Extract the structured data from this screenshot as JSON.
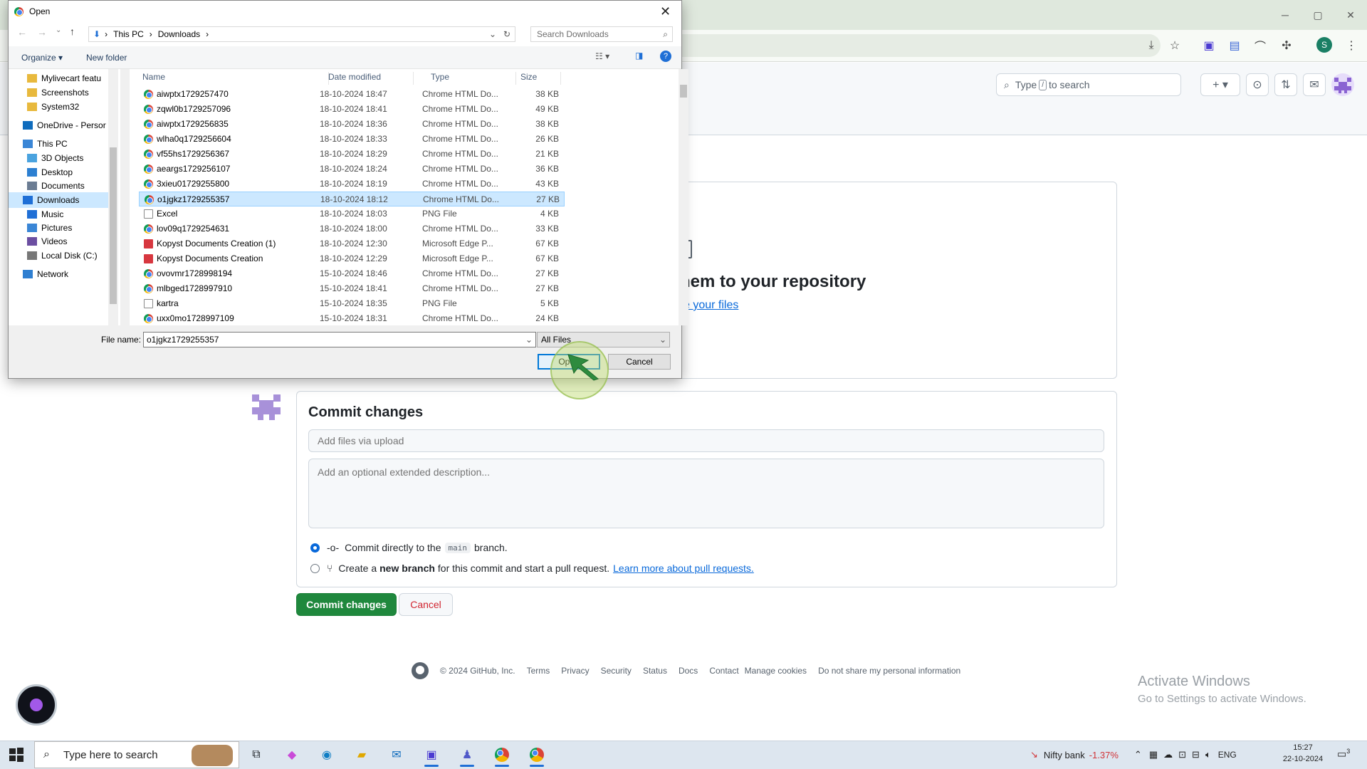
{
  "browser": {
    "window_controls": [
      "─",
      "▢",
      "✕"
    ]
  },
  "github": {
    "search": {
      "prefix": "Type",
      "key": "/",
      "suffix": "to search"
    },
    "upload": {
      "title": "hem to your repository",
      "link": "e your files"
    },
    "commit": {
      "title": "Commit changes",
      "summary_placeholder": "Add files via upload",
      "description_placeholder": "Add an optional extended description...",
      "option_direct": {
        "before": "Commit directly to the",
        "branch": "main",
        "after": "branch."
      },
      "option_new": {
        "before": "Create a",
        "bold": "new branch",
        "after": "for this commit and start a pull request.",
        "link": "Learn more about pull requests."
      },
      "commit_button": "Commit changes",
      "cancel_button": "Cancel"
    },
    "footer": [
      "© 2024 GitHub, Inc.",
      "Terms",
      "Privacy",
      "Security",
      "Status",
      "Docs",
      "Contact",
      "Manage cookies",
      "Do not share my personal information"
    ],
    "activate": {
      "line1": "Activate Windows",
      "line2": "Go to Settings to activate Windows."
    }
  },
  "dialog": {
    "title": "Open",
    "breadcrumb": [
      "This PC",
      "Downloads"
    ],
    "search_placeholder": "Search Downloads",
    "organize": "Organize ▾",
    "new_folder": "New folder",
    "nav": [
      {
        "label": "Mylivecart featu",
        "icon": "folder-icon"
      },
      {
        "label": "Screenshots",
        "icon": "folder-icon"
      },
      {
        "label": "System32",
        "icon": "folder-icon"
      },
      {
        "label": "OneDrive - Persor",
        "icon": "cloud-icon"
      },
      {
        "label": "This PC",
        "icon": "pc-icon"
      },
      {
        "label": "3D Objects",
        "icon": "cube-icon"
      },
      {
        "label": "Desktop",
        "icon": "desktop-icon"
      },
      {
        "label": "Documents",
        "icon": "document-icon"
      },
      {
        "label": "Downloads",
        "icon": "download-icon"
      },
      {
        "label": "Music",
        "icon": "music-icon"
      },
      {
        "label": "Pictures",
        "icon": "picture-icon"
      },
      {
        "label": "Videos",
        "icon": "video-icon"
      },
      {
        "label": "Local Disk (C:)",
        "icon": "disk-icon"
      },
      {
        "label": "Network",
        "icon": "network-icon"
      }
    ],
    "columns": [
      "Name",
      "Date modified",
      "Type",
      "Size"
    ],
    "files": [
      {
        "name": "aiwptx1729257470",
        "date": "18-10-2024 18:47",
        "type": "Chrome HTML Do...",
        "size": "38 KB",
        "icon": "chrome"
      },
      {
        "name": "zqwl0b1729257096",
        "date": "18-10-2024 18:41",
        "type": "Chrome HTML Do...",
        "size": "49 KB",
        "icon": "chrome"
      },
      {
        "name": "aiwptx1729256835",
        "date": "18-10-2024 18:36",
        "type": "Chrome HTML Do...",
        "size": "38 KB",
        "icon": "chrome"
      },
      {
        "name": "wlha0q1729256604",
        "date": "18-10-2024 18:33",
        "type": "Chrome HTML Do...",
        "size": "26 KB",
        "icon": "chrome"
      },
      {
        "name": "vf55hs1729256367",
        "date": "18-10-2024 18:29",
        "type": "Chrome HTML Do...",
        "size": "21 KB",
        "icon": "chrome"
      },
      {
        "name": "aeargs1729256107",
        "date": "18-10-2024 18:24",
        "type": "Chrome HTML Do...",
        "size": "36 KB",
        "icon": "chrome"
      },
      {
        "name": "3xieu01729255800",
        "date": "18-10-2024 18:19",
        "type": "Chrome HTML Do...",
        "size": "43 KB",
        "icon": "chrome"
      },
      {
        "name": "o1jgkz1729255357",
        "date": "18-10-2024 18:12",
        "type": "Chrome HTML Do...",
        "size": "27 KB",
        "icon": "chrome",
        "selected": true
      },
      {
        "name": "Excel",
        "date": "18-10-2024 18:03",
        "type": "PNG File",
        "size": "4 KB",
        "icon": "png"
      },
      {
        "name": "lov09q1729254631",
        "date": "18-10-2024 18:00",
        "type": "Chrome HTML Do...",
        "size": "33 KB",
        "icon": "chrome"
      },
      {
        "name": "Kopyst Documents Creation (1)",
        "date": "18-10-2024 12:30",
        "type": "Microsoft Edge P...",
        "size": "67 KB",
        "icon": "pdf"
      },
      {
        "name": "Kopyst Documents Creation",
        "date": "18-10-2024 12:29",
        "type": "Microsoft Edge P...",
        "size": "67 KB",
        "icon": "pdf"
      },
      {
        "name": "ovovmr1728998194",
        "date": "15-10-2024 18:46",
        "type": "Chrome HTML Do...",
        "size": "27 KB",
        "icon": "chrome"
      },
      {
        "name": "mlbged1728997910",
        "date": "15-10-2024 18:41",
        "type": "Chrome HTML Do...",
        "size": "27 KB",
        "icon": "chrome"
      },
      {
        "name": "kartra",
        "date": "15-10-2024 18:35",
        "type": "PNG File",
        "size": "5 KB",
        "icon": "png"
      },
      {
        "name": "uxx0mo1728997109",
        "date": "15-10-2024 18:31",
        "type": "Chrome HTML Do...",
        "size": "24 KB",
        "icon": "chrome"
      }
    ],
    "file_name_label": "File name:",
    "file_name_value": "o1jgkz1729255357",
    "filter_value": "All Files",
    "open_button": "Open",
    "cancel_button": "Cancel"
  },
  "taskbar": {
    "search_placeholder": "Type here to search",
    "ticker_name": "Nifty bank",
    "ticker_value": "-1.37%",
    "language": "ENG",
    "time": "15:27",
    "date": "22-10-2024",
    "notification_count": "3"
  }
}
